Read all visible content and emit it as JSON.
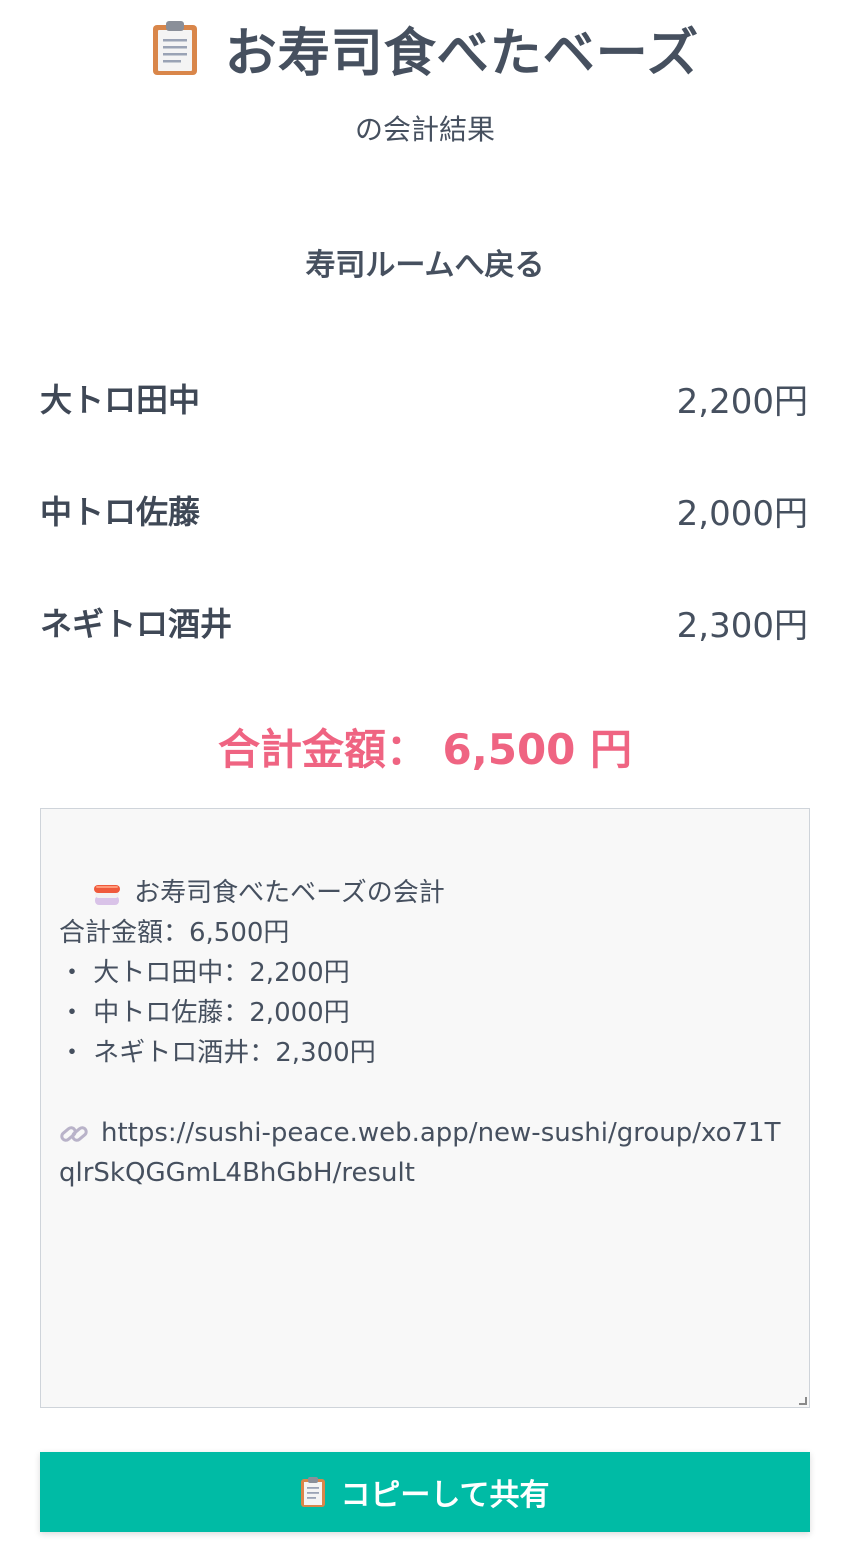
{
  "header": {
    "title": "お寿司食べたベーズ",
    "subtitle": "の会計結果",
    "title_icon": "clipboard-icon"
  },
  "nav": {
    "back_label": "寿司ルームへ戻る"
  },
  "members": [
    {
      "name": "大トロ田中",
      "amount": "2,200円"
    },
    {
      "name": "中トロ佐藤",
      "amount": "2,000円"
    },
    {
      "name": "ネギトロ酒井",
      "amount": "2,300円"
    }
  ],
  "total": {
    "label": "合計金額： 6,500 円"
  },
  "share_text": {
    "heading": "お寿司食べたベーズの会計",
    "total_line": "合計金額：6,500円",
    "items": [
      "・ 大トロ田中：2,200円",
      "・ 中トロ佐藤：2,000円",
      "・ ネギトロ酒井：2,300円"
    ],
    "url": "https://sushi-peace.web.app/new-sushi/group/xo71TqlrSkQGGmL4BhGbH/result",
    "heading_icon": "sushi-icon",
    "url_icon": "link-icon"
  },
  "copy_button": {
    "label": "コピーして共有",
    "icon": "clipboard-icon"
  },
  "colors": {
    "accent": "#00bba5",
    "total": "#ef6482",
    "text": "#46505f"
  }
}
